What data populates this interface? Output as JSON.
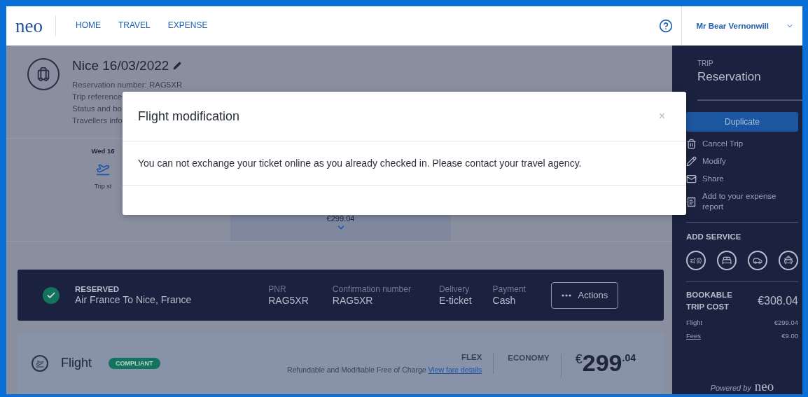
{
  "header": {
    "logo": "neo",
    "nav": [
      {
        "label": "HOME",
        "selected": false
      },
      {
        "label": "TRAVEL",
        "selected": false
      },
      {
        "label": "EXPENSE",
        "selected": false
      }
    ],
    "user": "Mr Bear Vernonwill"
  },
  "trip": {
    "title": "Nice 16/03/2022",
    "details": [
      "Reservation number: RAG5XR",
      "Trip reference",
      "Status and bo",
      "Travellers info"
    ]
  },
  "timeline": {
    "date": "Wed 16",
    "caption": "Trip st",
    "price": "€299.04"
  },
  "reservation": {
    "status": "RESERVED",
    "title": "Air France To Nice, France",
    "fields": [
      {
        "label": "PNR",
        "value": "RAG5XR"
      },
      {
        "label": "Confirmation number",
        "value": "RAG5XR"
      },
      {
        "label": "Delivery",
        "value": "E-ticket"
      },
      {
        "label": "Payment",
        "value": "Cash"
      }
    ],
    "actions": "Actions"
  },
  "flight": {
    "title": "Flight",
    "badge": "COMPLIANT",
    "fare": "FLEX",
    "fare_note": "Refundable and Modifiable Free of Charge",
    "fare_link": "View fare details",
    "cabin": "ECONOMY",
    "currency": "€",
    "price_main": "299",
    "price_cents": ".04"
  },
  "sidebar": {
    "label": "TRIP",
    "title": "Reservation",
    "primary_button": "Duplicate",
    "actions": [
      {
        "kind": "trash",
        "label": "Cancel Trip"
      },
      {
        "kind": "pencil",
        "label": "Modify"
      },
      {
        "kind": "mail",
        "label": "Share"
      },
      {
        "kind": "receipt",
        "label": "Add to your expense report"
      }
    ],
    "service_heading": "ADD SERVICE",
    "services": [
      {
        "kind": "flight-train"
      },
      {
        "kind": "hotel"
      },
      {
        "kind": "car"
      },
      {
        "kind": "taxi"
      }
    ],
    "cost": {
      "heading": "BOOKABLE TRIP COST",
      "total": "€308.04",
      "lines": [
        {
          "label": "Flight",
          "value": "€299.04",
          "link": false
        },
        {
          "label": "Fees",
          "value": "€9.00",
          "link": true
        }
      ]
    },
    "powered_by": "Powered by",
    "brand": "neo"
  },
  "modal": {
    "title": "Flight modification",
    "close": "×",
    "message": "You can not exchange your ticket online as you already checked in. Please contact your travel agency."
  }
}
